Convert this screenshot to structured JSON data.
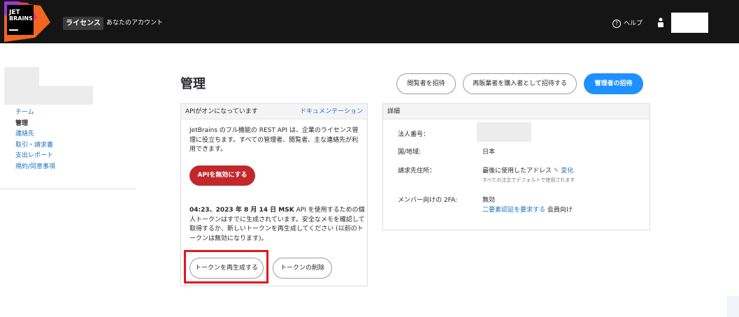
{
  "header": {
    "logo_text": "JET BRAINS",
    "nav_license": "ライセンス",
    "nav_account": "あなたのアカウント",
    "help_label": "ヘルプ",
    "help_icon_glyph": "?"
  },
  "sidebar": {
    "items": [
      {
        "label": "チーム",
        "active": false
      },
      {
        "label": "管理",
        "active": true
      },
      {
        "label": "連絡先",
        "active": false
      },
      {
        "label": "取引・請求書",
        "active": false
      },
      {
        "label": "支出レポート",
        "active": false
      },
      {
        "label": "規約/同意事項",
        "active": false
      }
    ]
  },
  "main": {
    "title": "管理",
    "buttons": {
      "invite_viewer": "閲覧者を招待",
      "invite_reseller": "再販業者を購入者として招待する",
      "invite_admin": "管理者の招待"
    }
  },
  "api_card": {
    "header_status": "APIがオンになっています",
    "doc_link": "ドキュメンテーション",
    "description": "JetBrains のフル機能の REST API は、企業のライセンス管理に役立ちます。すべての管理者、閲覧者、主な連絡先が利用できます。",
    "disable_button": "APIを無効にする",
    "token_time": "04:23、2023 年 8 月 14 日 MSK",
    "token_text": " API を使用するための個人トークンはすでに生成されています。安全なメモを確認して取得するか、新しいトークンを再生成してください (以前のトークンは無効になります)。",
    "regen_button": "トークンを再生成する",
    "delete_button": "トークンの削除"
  },
  "details_card": {
    "header": "詳細",
    "corp_number_label": "法人番号：",
    "region_label": "国/地域:",
    "region_value": "日本",
    "billing_label": "請求先住所：",
    "billing_value": "最後に使用したアドレス",
    "billing_edit": "変化",
    "billing_note": "すべての注文でデフォルトで使用されます",
    "twofa_label": "メンバー向けの 2FA:",
    "twofa_value": "無効",
    "twofa_link": "二要素認証を要求する",
    "twofa_suffix": " 会員向け"
  },
  "colors": {
    "topbar": "#151515",
    "accent_blue": "#1e90ff",
    "danger_red": "#c0282c",
    "link_blue": "#1e73be",
    "highlight_red": "#e0191c"
  }
}
